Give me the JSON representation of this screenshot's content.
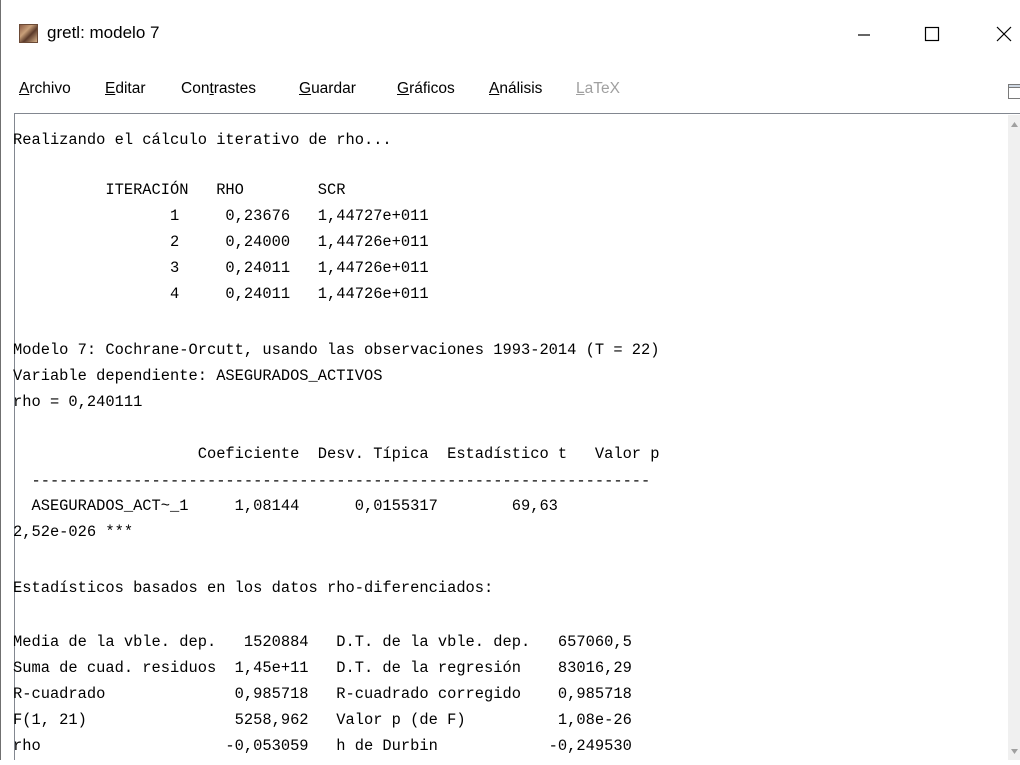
{
  "window": {
    "title": "gretl: modelo 7",
    "controls": [
      "minimize",
      "maximize",
      "close"
    ]
  },
  "menubar": {
    "items": [
      {
        "label": "Archivo",
        "mnemonic": "A",
        "rest": "rchivo",
        "pre": "",
        "disabled": false
      },
      {
        "label": "Editar",
        "mnemonic": "E",
        "rest": "ditar",
        "pre": "",
        "disabled": false
      },
      {
        "label": "Contrastes",
        "mnemonic": "t",
        "rest": "rastes",
        "pre": "Con",
        "disabled": false
      },
      {
        "label": "Guardar",
        "mnemonic": "G",
        "rest": "uardar",
        "pre": "",
        "disabled": false
      },
      {
        "label": "Gráficos",
        "mnemonic": "G",
        "rest": "ráficos",
        "pre": "",
        "disabled": false
      },
      {
        "label": "Análisis",
        "mnemonic": "A",
        "rest": "nálisis",
        "pre": "",
        "disabled": false
      },
      {
        "label": "LaTeX",
        "mnemonic": "L",
        "rest": "aTeX",
        "pre": "",
        "disabled": true
      }
    ]
  },
  "output": {
    "lines": [
      "Realizando el cálculo iterativo de rho...",
      "",
      "          ITERACIÓN   RHO        SCR",
      "                 1     0,23676   1,44727e+011",
      "                 2     0,24000   1,44726e+011",
      "                 3     0,24011   1,44726e+011",
      "                 4     0,24011   1,44726e+011",
      "",
      "Modelo 7: Cochrane-Orcutt, usando las observaciones 1993-2014 (T = 22)",
      "Variable dependiente: ASEGURADOS_ACTIVOS",
      "rho = 0,240111",
      "",
      "                    Coeficiente  Desv. Típica  Estadístico t   Valor p",
      "  -------------------------------------------------------------------",
      "  ASEGURADOS_ACT~_1     1,08144      0,0155317        69,63",
      "2,52e-026 ***",
      "",
      "Estadísticos basados en los datos rho-diferenciados:",
      "",
      "Media de la vble. dep.   1520884   D.T. de la vble. dep.   657060,5",
      "Suma de cuad. residuos  1,45e+11   D.T. de la regresión    83016,29",
      "R-cuadrado              0,985718   R-cuadrado corregido    0,985718",
      "F(1, 21)                5258,962   Valor p (de F)          1,08e-26",
      "rho                    -0,053059   h de Durbin            -0,249530"
    ]
  }
}
